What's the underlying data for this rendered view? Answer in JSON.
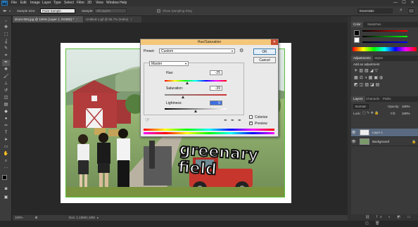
{
  "menubar": {
    "logo": "Ps",
    "items": [
      "File",
      "Edit",
      "Image",
      "Layer",
      "Type",
      "Select",
      "Filter",
      "3D",
      "View",
      "Window",
      "Help"
    ],
    "window_controls": [
      "—",
      "☐",
      "✕"
    ]
  },
  "options": {
    "sample_size_label": "Sample Size:",
    "sample_size_value": "Point Sample",
    "sample_label": "Sample:",
    "sample_value": "All Layers",
    "show_ring_label": "Show Sampling Ring",
    "workspace_value": "Essentials"
  },
  "tabs": [
    {
      "label": "dcom-004.jpg @ 100% (Layer 1, RGB/8) *",
      "close": "×"
    },
    {
      "label": "Untitled-1.gif @ 66.7% (Index)",
      "close": "×"
    }
  ],
  "status": {
    "zoom": "100%",
    "doc": "Doc: 1.10M/1.10M"
  },
  "image": {
    "caption": "greenary field"
  },
  "dialog": {
    "title": "Hue/Saturation",
    "close": "✕",
    "preset_label": "Preset:",
    "preset_value": "Custom",
    "channel_value": "Master",
    "hue_label": "Hue:",
    "hue_value": "-25",
    "saturation_label": "Saturation:",
    "saturation_value": "-39",
    "lightness_label": "Lightness:",
    "lightness_value": "0",
    "ok_label": "OK",
    "cancel_label": "Cancel",
    "colorize_label": "Colorize",
    "preview_label": "Preview"
  },
  "panels": {
    "color_tabs": [
      "Color",
      "Swatches"
    ],
    "adjust_tabs": [
      "Adjustments",
      "Styles"
    ],
    "adjust_subtitle": "Add an adjustment",
    "layers_tabs": [
      "Layers",
      "Channels",
      "Paths"
    ],
    "blend_mode": "Normal",
    "opacity_label": "Opacity:",
    "opacity_value": "100%",
    "lock_label": "Lock:",
    "fill_label": "Fill:",
    "fill_value": "100%",
    "layers": [
      {
        "name": "Layer 1",
        "selected": true
      },
      {
        "name": "Background",
        "selected": false
      }
    ]
  },
  "colors": {
    "accent": "#3d6fe0",
    "dialog_title": "#f4c67a",
    "image_border": "#5bbf3a",
    "selected_layer": "#5a6a80"
  }
}
